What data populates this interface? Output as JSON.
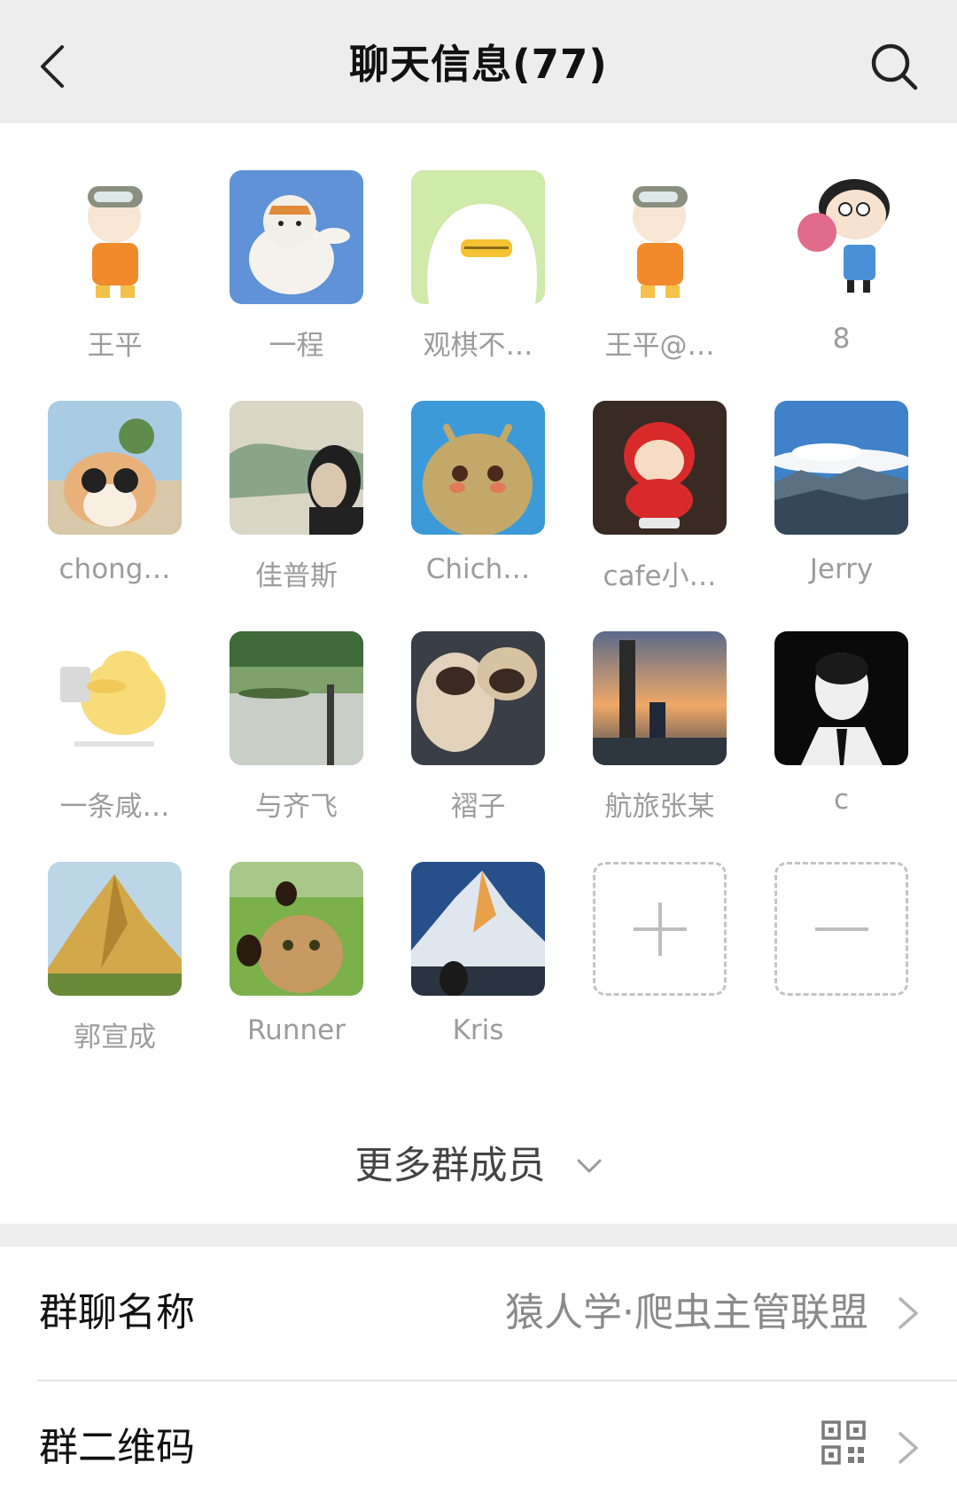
{
  "header": {
    "title": "聊天信息(77)",
    "back_icon": "chevron-left-icon",
    "search_icon": "search-icon"
  },
  "members": [
    {
      "name": "王平",
      "avatar": "firefighter-cartoon"
    },
    {
      "name": "一程",
      "avatar": "tiger-cartoon"
    },
    {
      "name": "观棋不…",
      "avatar": "white-duck-cartoon"
    },
    {
      "name": "王平@…",
      "avatar": "firefighter-cartoon"
    },
    {
      "name": "8",
      "avatar": "crayon-shin-chan-flowers"
    },
    {
      "name": "chong…",
      "avatar": "corgi-sunglasses"
    },
    {
      "name": "佳普斯",
      "avatar": "man-sketch"
    },
    {
      "name": "Chich…",
      "avatar": "dragon-plush"
    },
    {
      "name": "cafe小…",
      "avatar": "shin-chan-figure"
    },
    {
      "name": "Jerry",
      "avatar": "mountain-clouds"
    },
    {
      "name": "一条咸…",
      "avatar": "psyduck-sketch"
    },
    {
      "name": "与齐飞",
      "avatar": "lake-reflection"
    },
    {
      "name": "褶子",
      "avatar": "pug-dogs"
    },
    {
      "name": "航旅张某",
      "avatar": "seaside-sunset"
    },
    {
      "name": "c",
      "avatar": "man-portrait-bw"
    },
    {
      "name": "郭宣成",
      "avatar": "golden-mountain"
    },
    {
      "name": "Runner",
      "avatar": "cat-dogs-selfie"
    },
    {
      "name": "Kris",
      "avatar": "everest-peak"
    }
  ],
  "actions": {
    "add_icon": "plus-icon",
    "remove_icon": "minus-icon"
  },
  "more_members": {
    "label": "更多群成员",
    "icon": "chevron-down-icon"
  },
  "settings": {
    "group_name": {
      "label": "群聊名称",
      "value": "猿人学·爬虫主管联盟"
    },
    "group_qr": {
      "label": "群二维码",
      "icon": "qr-code-icon"
    }
  }
}
